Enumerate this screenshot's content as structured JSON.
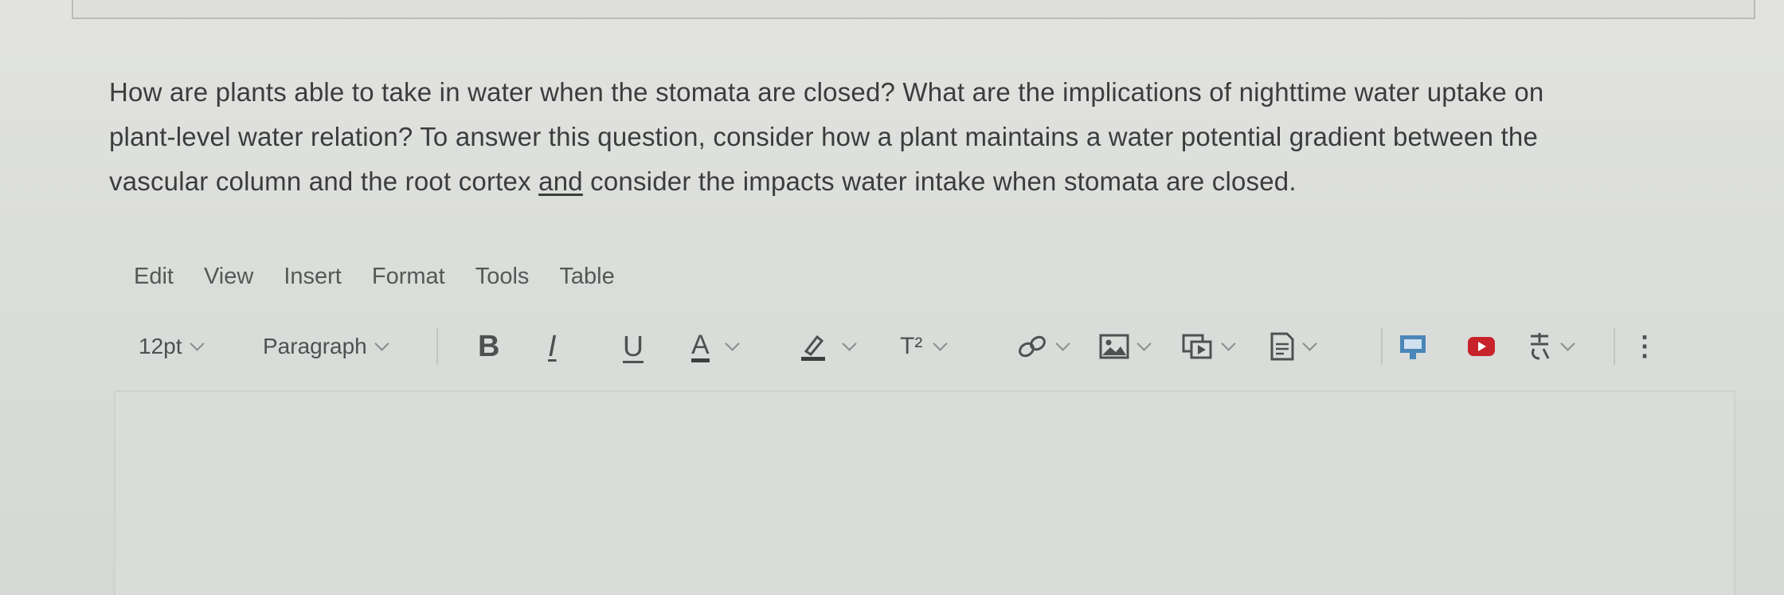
{
  "question": {
    "line1": "How are plants able to take in water when the stomata are closed? What are the implications of nighttime water uptake on",
    "line2": "plant-level water relation? To answer this question, consider how a plant maintains a water potential gradient between the",
    "line3_before": "vascular column and the root cortex ",
    "line3_underlined": "and",
    "line3_after": " consider the impacts water intake when stomata are closed."
  },
  "menubar": {
    "items": [
      "Edit",
      "View",
      "Insert",
      "Format",
      "Tools",
      "Table"
    ]
  },
  "toolbar": {
    "font_size": "12pt",
    "block_format": "Paragraph",
    "bold_label": "B",
    "italic_label": "I",
    "underline_label": "U",
    "text_color_label": "A",
    "superscript_label": "T²",
    "more_label": "⋮",
    "colors": {
      "youtube_red": "#c8232a",
      "media_blue": "#4a86b8",
      "icon_gray": "#4e5150"
    }
  },
  "editor": {
    "content": ""
  }
}
